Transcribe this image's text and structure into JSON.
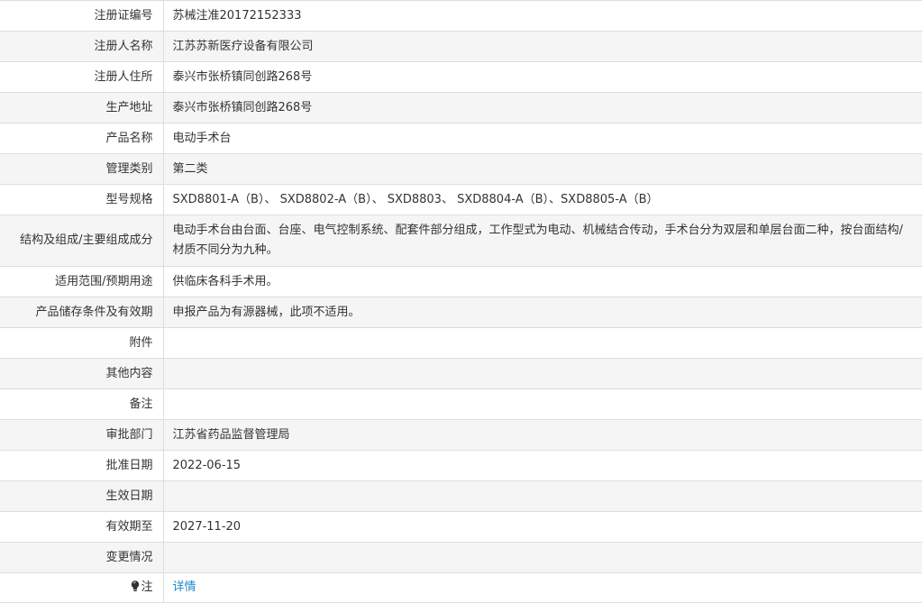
{
  "rows": [
    {
      "label": "注册证编号",
      "value": "苏械注准20172152333"
    },
    {
      "label": "注册人名称",
      "value": "江苏苏新医疗设备有限公司"
    },
    {
      "label": "注册人住所",
      "value": "泰兴市张桥镇同创路268号"
    },
    {
      "label": "生产地址",
      "value": "泰兴市张桥镇同创路268号"
    },
    {
      "label": "产品名称",
      "value": "电动手术台"
    },
    {
      "label": "管理类别",
      "value": "第二类"
    },
    {
      "label": "型号规格",
      "value": "SXD8801-A（B）、 SXD8802-A（B）、 SXD8803、 SXD8804-A（B）、SXD8805-A（B）"
    },
    {
      "label": "结构及组成/主要组成成分",
      "value": "电动手术台由台面、台座、电气控制系统、配套件部分组成，工作型式为电动、机械结合传动，手术台分为双层和单层台面二种，按台面结构/材质不同分为九种。"
    },
    {
      "label": "适用范围/预期用途",
      "value": "供临床各科手术用。"
    },
    {
      "label": "产品储存条件及有效期",
      "value": "申报产品为有源器械，此项不适用。"
    },
    {
      "label": "附件",
      "value": ""
    },
    {
      "label": "其他内容",
      "value": ""
    },
    {
      "label": "备注",
      "value": ""
    },
    {
      "label": "审批部门",
      "value": "江苏省药品监督管理局"
    },
    {
      "label": "批准日期",
      "value": "2022-06-15"
    },
    {
      "label": "生效日期",
      "value": ""
    },
    {
      "label": "有效期至",
      "value": "2027-11-20"
    },
    {
      "label": "变更情况",
      "value": ""
    }
  ],
  "note": {
    "icon": "lightbulb-icon",
    "label": "注",
    "link_text": "详情",
    "link_color": "#1e87c9"
  }
}
